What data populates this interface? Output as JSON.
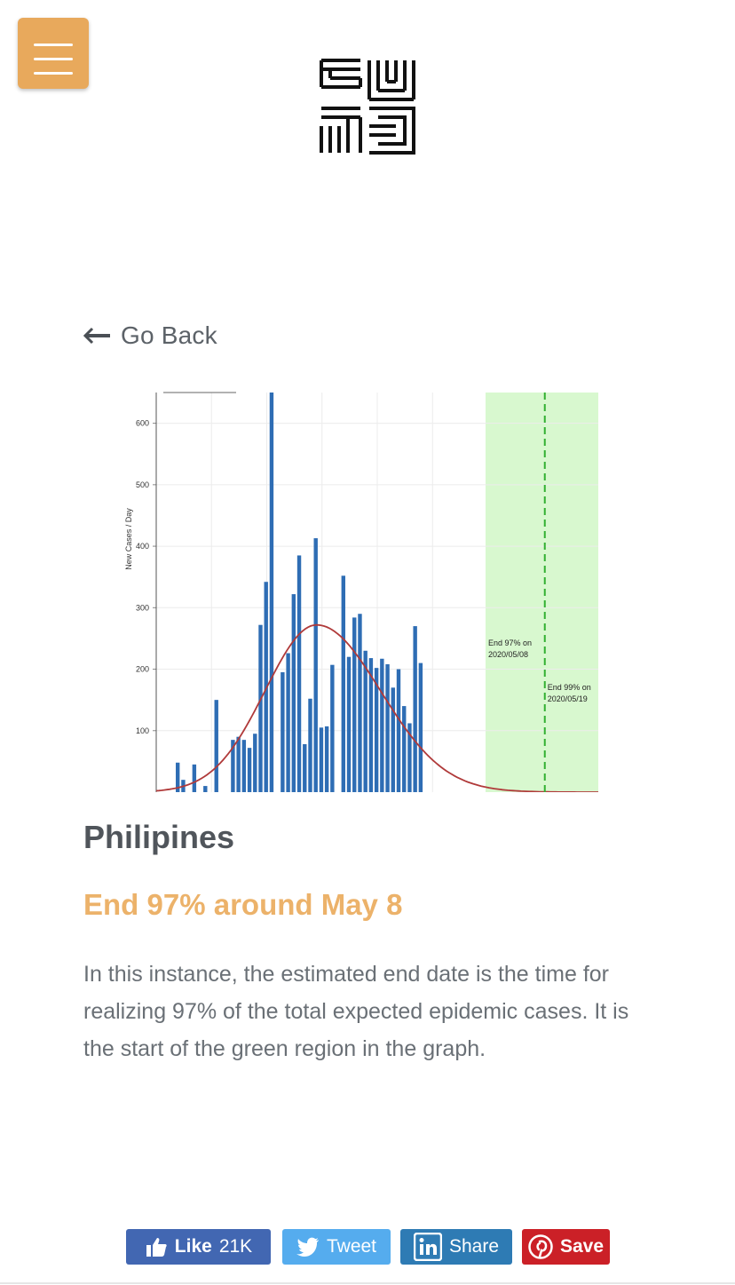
{
  "header": {
    "menu_icon": "hamburger-menu-icon",
    "logo_icon": "maze-logo-icon"
  },
  "nav": {
    "go_back_label": "Go Back"
  },
  "article": {
    "country": "Philipines",
    "headline": "End 97% around May 8",
    "description": "In this instance, the estimated end date is the time for realizing 97% of the total expected epidemic cases. It is the start of the green region in the graph."
  },
  "chart_data": {
    "type": "bar",
    "ylabel": "New Cases / Day",
    "yticks": [
      100,
      200,
      300,
      400,
      500,
      600
    ],
    "ylim": [
      0,
      650
    ],
    "values": [
      48,
      20,
      0,
      45,
      0,
      10,
      0,
      150,
      0,
      0,
      85,
      90,
      85,
      72,
      95,
      272,
      342,
      650,
      0,
      195,
      226,
      322,
      385,
      78,
      152,
      413,
      105,
      107,
      207,
      0,
      352,
      220,
      284,
      290,
      230,
      218,
      202,
      217,
      208,
      170,
      200,
      140,
      112,
      270,
      210
    ],
    "fit_curve_peak": 272,
    "annotations": [
      {
        "label": "End 97% on",
        "date": "2020/05/08"
      },
      {
        "label": "End 99% on",
        "date": "2020/05/19"
      }
    ],
    "colors": {
      "bars": "#2e6db4",
      "fit": "#b03a3a",
      "region": "#d8f8cf",
      "dashed": "#32b032"
    }
  },
  "share": {
    "facebook": {
      "label": "Like",
      "count": "21K",
      "icon": "thumbs-up-icon"
    },
    "twitter": {
      "label": "Tweet",
      "icon": "twitter-bird-icon"
    },
    "linkedin": {
      "label": "Share",
      "icon": "linkedin-icon"
    },
    "pinterest": {
      "label": "Save",
      "icon": "pinterest-icon"
    }
  }
}
